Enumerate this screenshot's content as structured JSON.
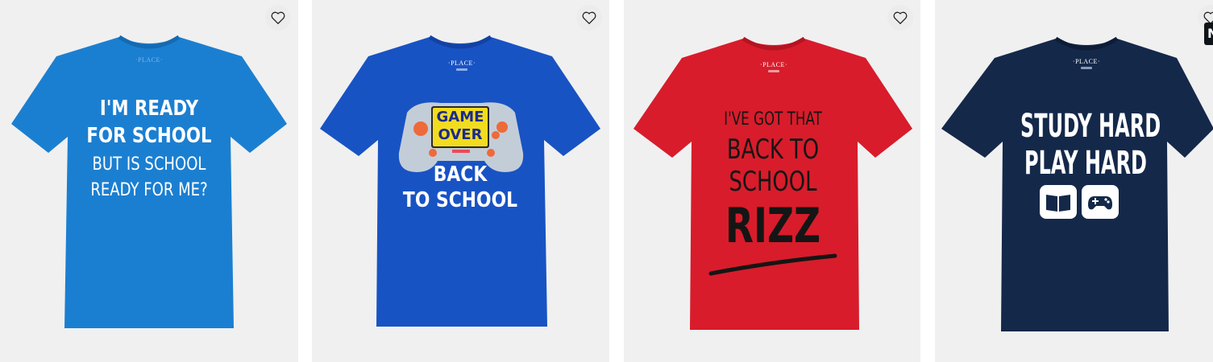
{
  "products": [
    {
      "brand": "·PLACE·",
      "shirt_color": "#1b7fd1",
      "text_color": "#ffffff",
      "lines": [
        "I'M READY",
        "FOR SCHOOL",
        "BUT IS SCHOOL",
        "READY FOR ME?"
      ]
    },
    {
      "brand": "·PLACE·",
      "shirt_color": "#1853c4",
      "text_color": "#ffffff",
      "controller_words": [
        "GAME",
        "OVER"
      ],
      "lines": [
        "BACK",
        "TO SCHOOL"
      ]
    },
    {
      "brand": "·PLACE·",
      "shirt_color": "#d81c2b",
      "text_color": "#151515",
      "lines": [
        "I'VE GOT THAT",
        "BACK TO",
        "SCHOOL",
        "RIZZ"
      ]
    },
    {
      "brand": "·PLACE·",
      "shirt_color": "#14284a",
      "text_color": "#ffffff",
      "lines": [
        "STUDY HARD",
        "PLAY HARD"
      ],
      "icons": [
        "book-icon",
        "game-controller-icon"
      ]
    }
  ],
  "favorite_icon": "heart-outline-icon",
  "corner_badge": "N"
}
